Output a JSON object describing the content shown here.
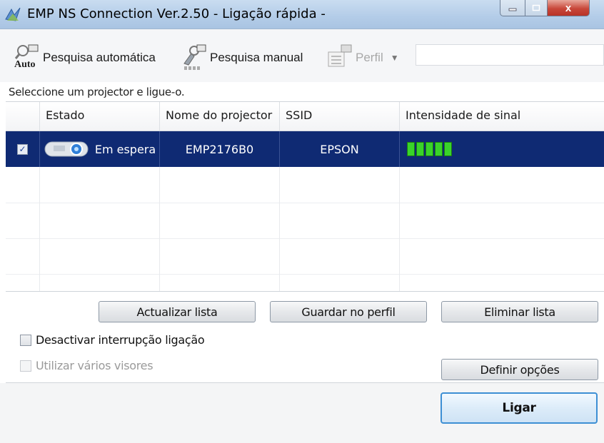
{
  "window": {
    "title": "EMP NS Connection Ver.2.50 - Ligação rápida -",
    "controls": {
      "minimize": "minimize-icon",
      "maximize": "maximize-icon",
      "close": "x"
    }
  },
  "toolbar": {
    "auto_search": {
      "label": "Pesquisa automática",
      "icon_text": "Auto"
    },
    "manual_search": {
      "label": "Pesquisa manual"
    },
    "profile": {
      "label": "Perfil",
      "enabled": false,
      "selected_value": ""
    }
  },
  "instruction": "Seleccione um projector e ligue-o.",
  "table": {
    "columns": [
      "Estado",
      "Nome do projector",
      "SSID",
      "Intensidade de sinal"
    ],
    "rows": [
      {
        "checked": true,
        "status": "Em espera",
        "projector_name": "EMP2176B0",
        "ssid": "EPSON",
        "signal_bars": 5
      }
    ]
  },
  "buttons": {
    "refresh": "Actualizar lista",
    "save_profile": "Guardar no perfil",
    "delete_list": "Eliminar lista",
    "set_options": "Definir opções",
    "connect": "Ligar"
  },
  "options": {
    "disable_interrupt": {
      "label": "Desactivar interrupção ligação",
      "checked": false,
      "enabled": true
    },
    "multi_display": {
      "label": "Utilizar vários visores",
      "checked": false,
      "enabled": false
    }
  },
  "colors": {
    "selection": "#0f2a73",
    "signal": "#39d42a",
    "default_button_border": "#3d8fd4"
  }
}
